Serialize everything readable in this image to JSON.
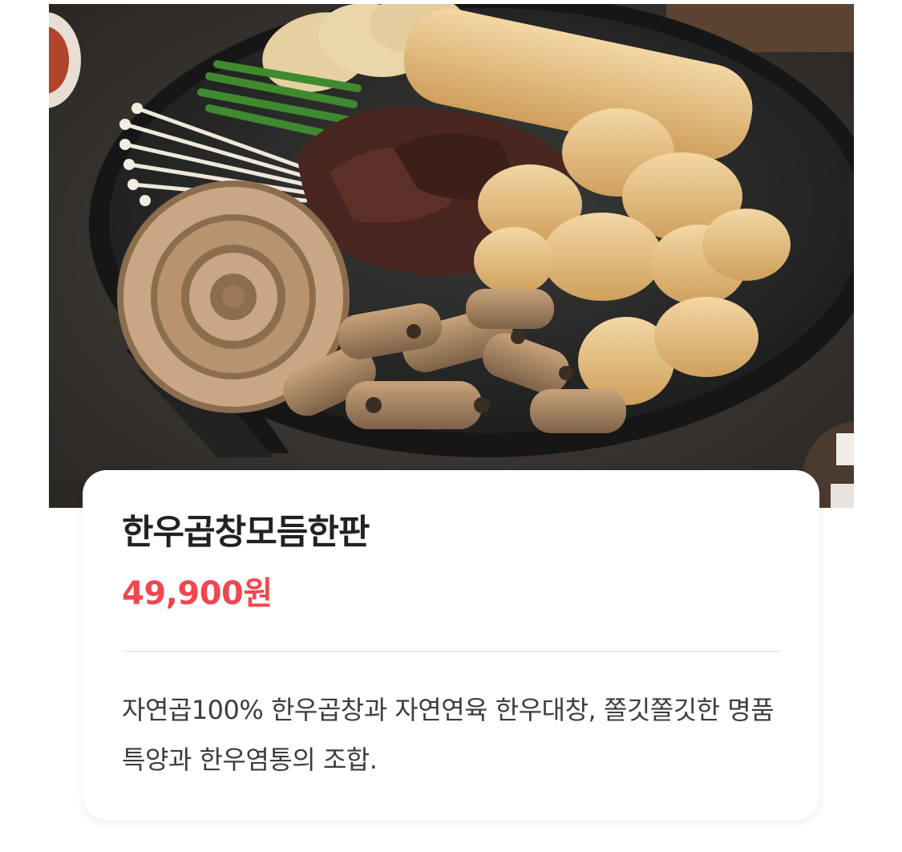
{
  "product": {
    "image_icon": "food-photo",
    "title": "한우곱창모듬한판",
    "price": "49,900원",
    "description": "자연곱100% 한우곱창과 자연연육 한우대창, 쫄깃쫄깃한 명품 특양과 한우염통의 조합."
  },
  "colors": {
    "price": "#f0474f",
    "title": "#222222",
    "description": "#3d3d3d",
    "card_background": "#ffffff"
  }
}
